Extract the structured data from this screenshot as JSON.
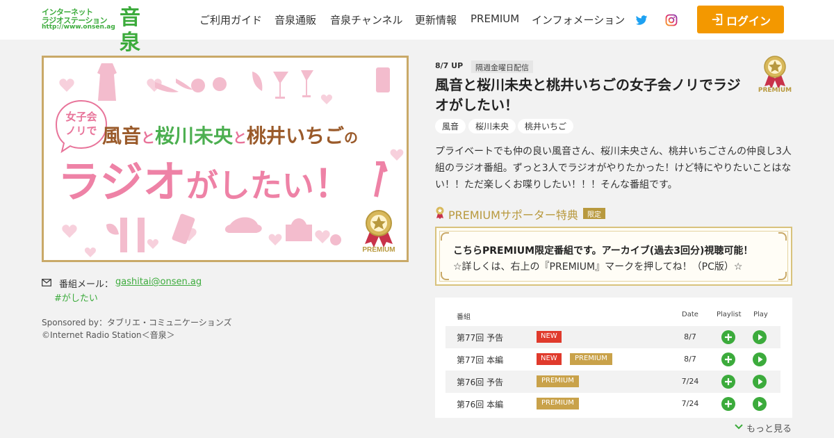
{
  "header": {
    "logo_line1": "インターネット",
    "logo_line2": "ラジオステーション",
    "logo_line3": "http://www.onsen.ag",
    "logo_kanji": "音泉",
    "nav": [
      "ご利用ガイド",
      "音泉通販",
      "音泉チャンネル",
      "更新情報",
      "PREMIUM",
      "インフォメーション"
    ],
    "login_label": "ログイン",
    "accent_color": "#f39800",
    "brand_color": "#3cab3c"
  },
  "keyvisual": {
    "bubble_line1": "女子会",
    "bubble_line2": "ノリで",
    "names": [
      "風音",
      "と",
      "桜川未央",
      "と",
      "桃井いちご",
      "の"
    ],
    "main_line_a": "ラジオ",
    "main_line_b": "がしたい",
    "main_line_c": "！",
    "badge_label": "PREMIUM"
  },
  "contact": {
    "mail_label": "番組メール：",
    "mail_address": "gashitai@onsen.ag",
    "hashtag": "#がしたい",
    "sponsor": "Sponsored by：タブリエ・コミュニケーションズ",
    "copyright": "©Internet Radio Station＜音泉＞"
  },
  "program": {
    "update": "8/7 UP",
    "schedule": "隔週金曜日配信",
    "title": "風音と桜川未央と桃井いちごの女子会ノリでラジオがしたい！",
    "tags": [
      "風音",
      "桜川未央",
      "桃井いちご"
    ],
    "premium_mark": "PREMIUM",
    "description": "プライベートでも仲の良い風音さん、桜川未央さん、桃井いちごさんの仲良し3人組のラジオ番組。ずっと3人でラジオがやりたかった！けど特にやりたいことはない！！ただ楽しくお喋りしたい！！！そんな番組です。",
    "supporter_label": "PREMIUMサポーター特典",
    "limited_label": "限定",
    "notice_line1": "こちらPREMIUM限定番組です。アーカイブ(過去3回分)視聴可能！",
    "notice_line2": "☆詳しくは、右上の『PREMIUM』マークを押してね！（PC版）☆"
  },
  "playlist": {
    "headers": {
      "program": "番組",
      "date": "Date",
      "playlist": "Playlist",
      "play": "Play"
    },
    "rows": [
      {
        "episode": "第77回 予告",
        "new": "NEW",
        "premium": "",
        "date": "8/7"
      },
      {
        "episode": "第77回 本編",
        "new": "NEW",
        "premium": "PREMIUM",
        "date": "8/7"
      },
      {
        "episode": "第76回 予告",
        "new": "",
        "premium": "PREMIUM",
        "date": "7/24"
      },
      {
        "episode": "第76回 本編",
        "new": "",
        "premium": "PREMIUM",
        "date": "7/24"
      }
    ],
    "more_label": "もっと見る"
  }
}
